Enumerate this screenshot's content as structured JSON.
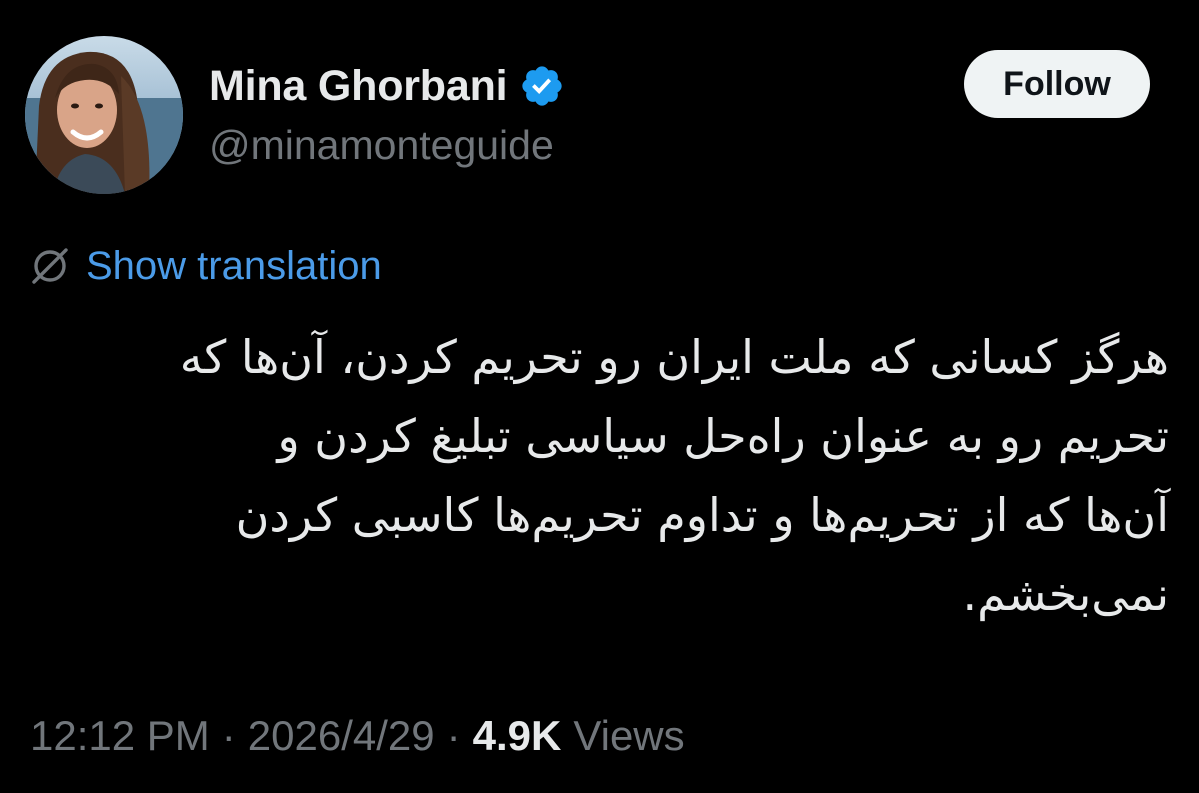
{
  "author": {
    "display_name": "Mina Ghorbani",
    "handle": "@minamonteguide",
    "verified_icon": "verified-badge-icon",
    "avatar_icon": "profile-photo"
  },
  "actions": {
    "follow_label": "Follow"
  },
  "translation": {
    "icon": "globe-slash-icon",
    "label": "Show translation"
  },
  "tweet": {
    "lines": [
      "هرگز کسانی که ملت ایران رو تحریم کردن، آن‌ها که",
      "تحریم رو به عنوان راه‌حل سیاسی تبلیغ کردن و",
      "آن‌ها که از تحریم‌ها و تداوم تحریم‌ها کاسبی کردن",
      "نمی‌بخشم."
    ]
  },
  "meta": {
    "time": "12:12 PM",
    "separator": "·",
    "date": "2026/4/29",
    "views_count": "4.9K",
    "views_label": "Views"
  },
  "colors": {
    "background": "#000000",
    "primary_text": "#e7e9ea",
    "secondary_text": "#71767b",
    "link": "#4b9be8",
    "verified": "#1d9bf0",
    "follow_button_bg": "#eff3f4",
    "follow_button_text": "#0f1419"
  }
}
